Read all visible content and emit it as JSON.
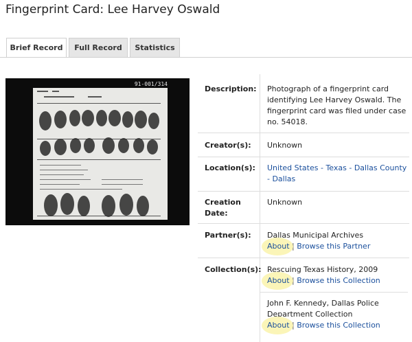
{
  "page": {
    "title": "Fingerprint Card: Lee Harvey Oswald"
  },
  "tabs": [
    {
      "label": "Brief Record",
      "active": true
    },
    {
      "label": "Full Record",
      "active": false
    },
    {
      "label": "Statistics",
      "active": false
    }
  ],
  "image": {
    "card_number": "91-001/314",
    "alt": "Fingerprint card photograph"
  },
  "details": {
    "description_label": "Description:",
    "description_value": "Photograph of a fingerprint card identifying Lee Harvey Oswald. The fingerprint card was filed under case no. 54018.",
    "creator_label": "Creator(s):",
    "creator_value": "Unknown",
    "location_label": "Location(s):",
    "location_value": "United States - Texas - Dallas County - Dallas",
    "creation_date_label": "Creation Date:",
    "creation_date_value": "Unknown",
    "partner_label": "Partner(s):",
    "partner_name": "Dallas Municipal Archives",
    "partner_about": "About",
    "partner_browse": "Browse this Partner",
    "collection_label": "Collection(s):",
    "collections": [
      {
        "name": "Rescuing Texas History, 2009",
        "about": "About",
        "browse": "Browse this Collection"
      },
      {
        "name": "John F. Kennedy, Dallas Police Department Collection",
        "about": "About",
        "browse": "Browse this Collection"
      }
    ],
    "separator": "|"
  },
  "colors": {
    "link": "#1a4f9c",
    "highlight": "#fbf4b4",
    "tab_bg": "#e6e6e6"
  }
}
